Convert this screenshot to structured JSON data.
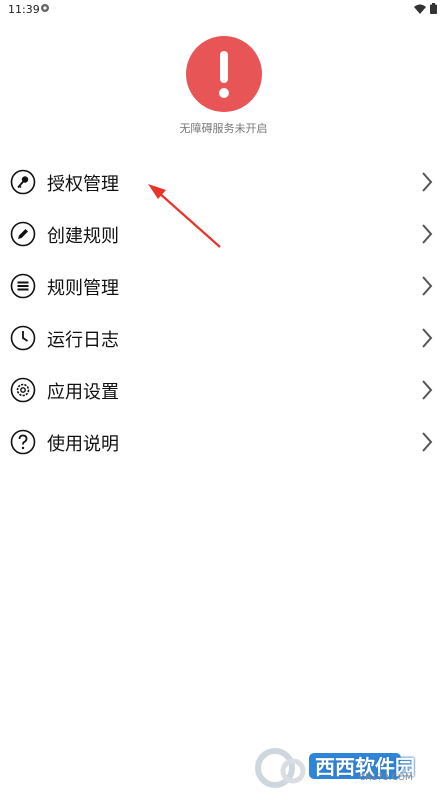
{
  "status_bar": {
    "time": "11:39"
  },
  "accessibility": {
    "status_text": "无障碍服务未开启",
    "alert_color": "#e85557"
  },
  "menu": {
    "items": [
      {
        "label": "授权管理",
        "icon": "key-icon"
      },
      {
        "label": "创建规则",
        "icon": "pencil-icon"
      },
      {
        "label": "规则管理",
        "icon": "list-icon"
      },
      {
        "label": "运行日志",
        "icon": "clock-icon"
      },
      {
        "label": "应用设置",
        "icon": "gear-icon"
      },
      {
        "label": "使用说明",
        "icon": "help-icon"
      }
    ]
  },
  "annotation": {
    "arrow_color": "#e8342a"
  },
  "watermark": {
    "brand": "西西软件园",
    "url": "CR173.COM"
  }
}
